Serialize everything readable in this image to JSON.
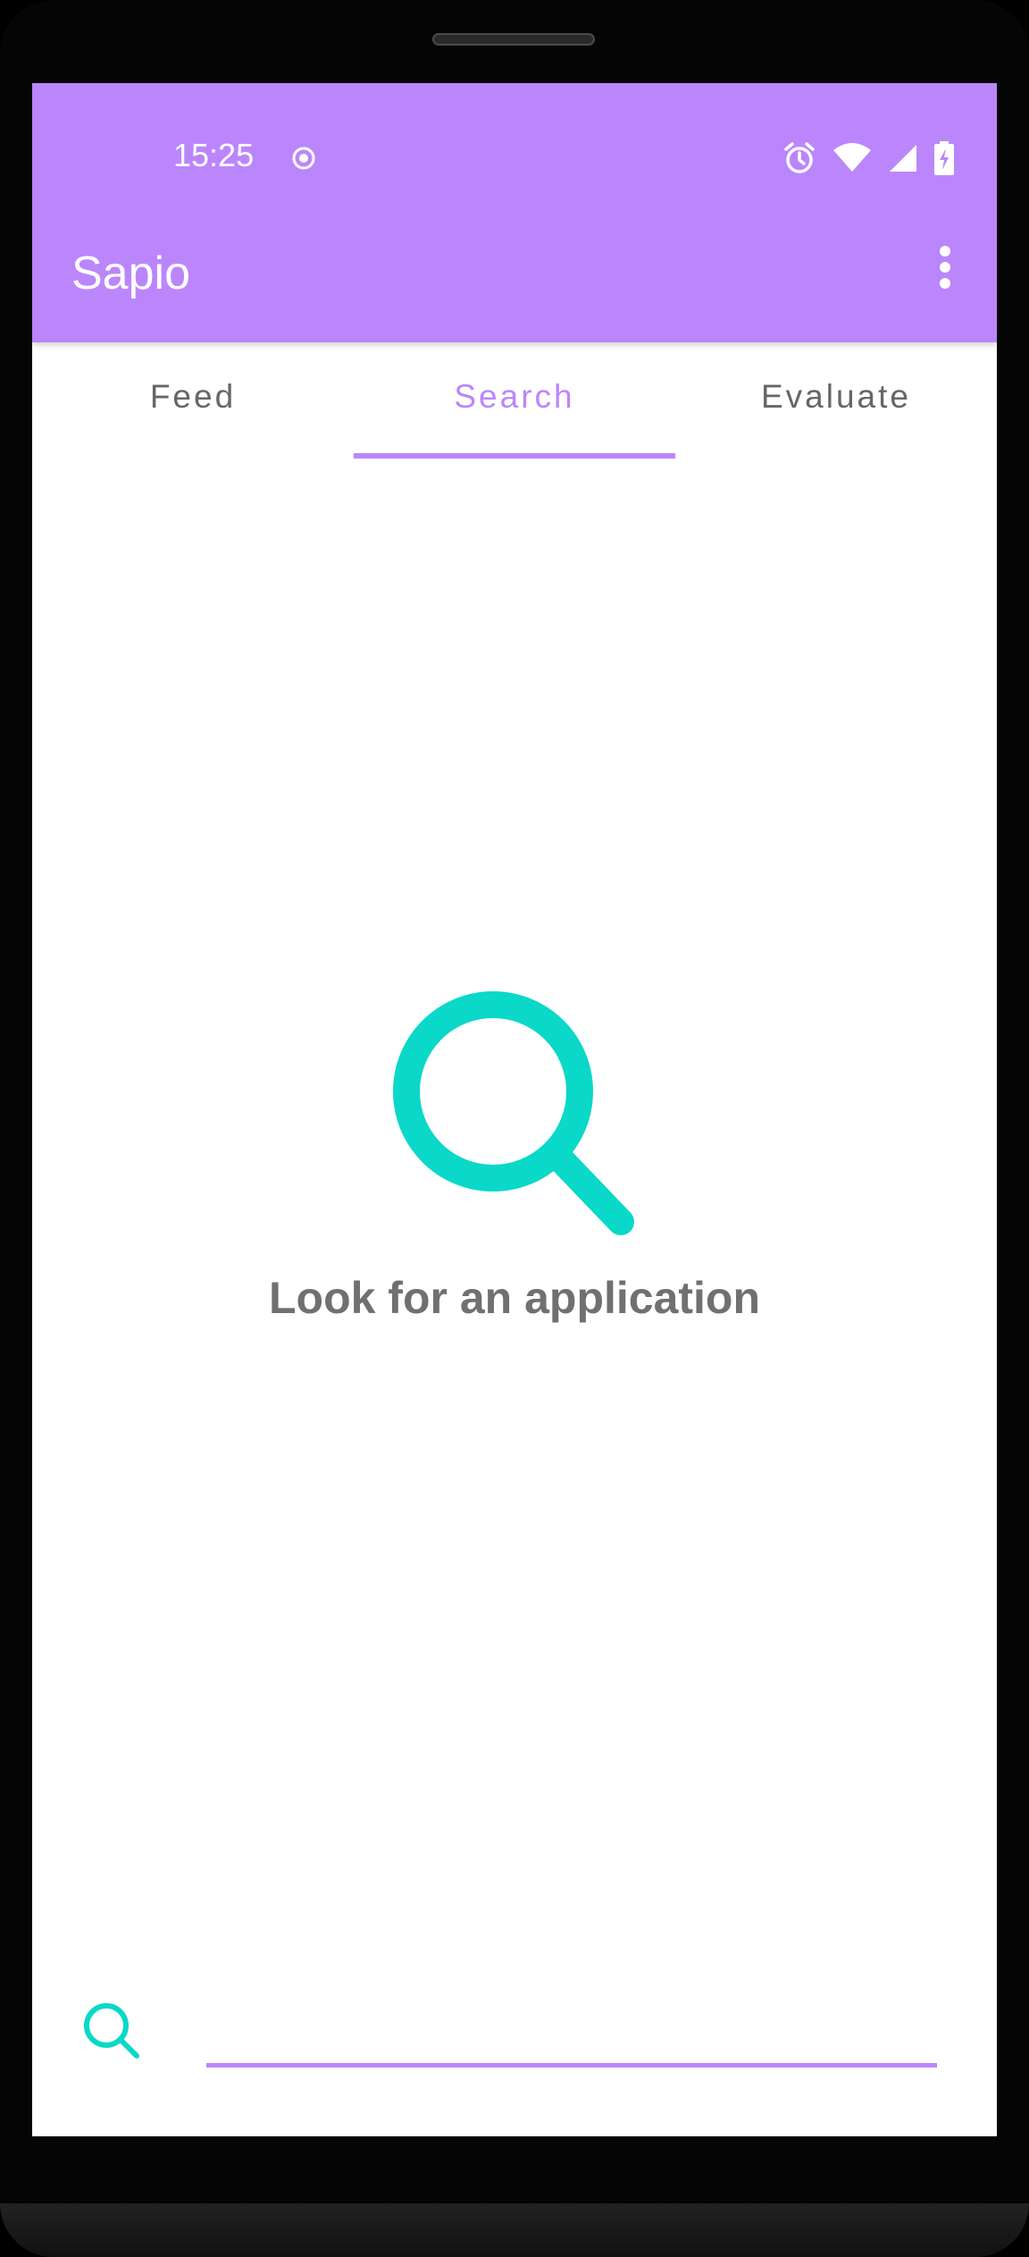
{
  "status_bar": {
    "time": "15:25"
  },
  "app_bar": {
    "title": "Sapio",
    "background_color": "#bb86fc"
  },
  "tabs": [
    {
      "label": "Feed",
      "active": false
    },
    {
      "label": "Search",
      "active": true
    },
    {
      "label": "Evaluate",
      "active": false
    }
  ],
  "empty_state": {
    "icon": "search-icon",
    "icon_color": "#0ad8c8",
    "message": "Look for an application"
  },
  "search": {
    "icon": "search-icon",
    "value": "",
    "placeholder": ""
  },
  "colors": {
    "accent": "#bb86fc",
    "teal": "#0ad8c8",
    "tab_inactive": "#666666",
    "text_secondary": "#707070"
  }
}
